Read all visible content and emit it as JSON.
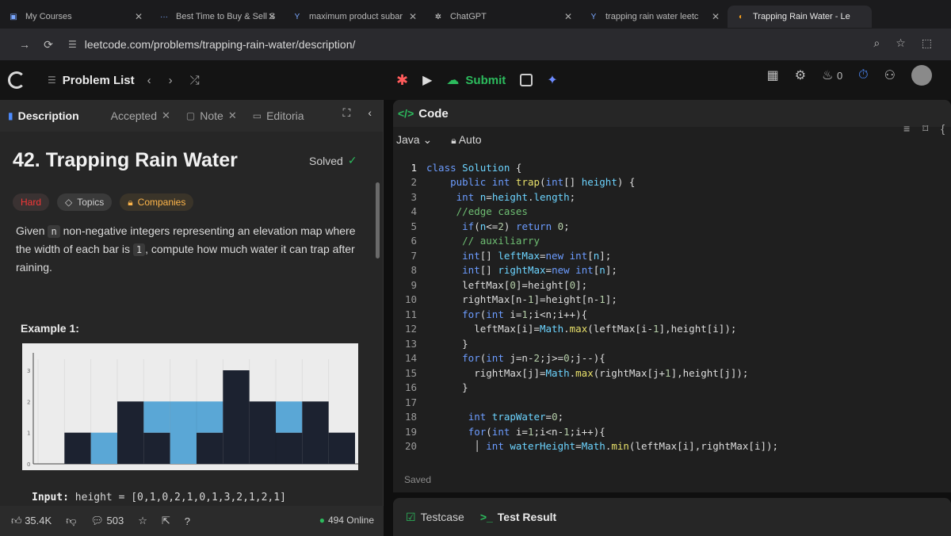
{
  "browser": {
    "tabs": [
      {
        "label": "My Courses"
      },
      {
        "label": "Best Time to Buy & Sell S"
      },
      {
        "label": "maximum product subar"
      },
      {
        "label": "ChatGPT"
      },
      {
        "label": "trapping rain water leetc"
      },
      {
        "label": "Trapping Rain Water - Le"
      }
    ],
    "url": "leetcode.com/problems/trapping-rain-water/description/"
  },
  "header": {
    "problem_list": "Problem List",
    "submit_label": "Submit",
    "streak_count": "0"
  },
  "left": {
    "tabs": {
      "description": "Description",
      "accepted": "Accepted",
      "note": "Note",
      "editorial": "Editoria"
    },
    "title": "42. Trapping Rain Water",
    "solved": "Solved",
    "badges": {
      "difficulty": "Hard",
      "topics": "Topics",
      "companies": "Companies"
    },
    "description": {
      "p1": "Given ",
      "n": "n",
      "p2": " non-negative integers representing an elevation map where the width of each bar is ",
      "one": "1",
      "p3": ", compute how much water it can trap after raining."
    },
    "example_title": "Example 1:",
    "input_label": "Input:",
    "input_value": " height = [0,1,0,2,1,0,1,3,2,1,2,1]",
    "footer": {
      "likes": "35.4K",
      "comments": "503",
      "online": "494 Online"
    }
  },
  "diagram": {
    "heights": [
      0,
      1,
      0,
      2,
      1,
      0,
      1,
      3,
      2,
      1,
      2,
      1
    ],
    "water": [
      0,
      0,
      1,
      0,
      1,
      2,
      1,
      0,
      0,
      1,
      0,
      0
    ],
    "bar_color": "#1c2230",
    "water_color": "#5aa7d6",
    "y_ticks": [
      "0",
      "1",
      "2",
      "3"
    ]
  },
  "code": {
    "title": "Code",
    "language": "Java",
    "mode": "Auto",
    "status": "Saved",
    "lines": [
      {
        "n": "1",
        "html": "<span class='kw'>class</span> <span class='tp'>Solution</span> {"
      },
      {
        "n": "2",
        "html": "    <span class='kw'>public</span> <span class='kw'>int</span> <span class='fn'>trap</span>(<span class='kw'>int</span>[] <span class='tp'>height</span>) {"
      },
      {
        "n": "3",
        "html": "     <span class='kw'>int</span> <span class='tp'>n</span>=<span class='tp'>height</span>.<span class='tp'>length</span>;"
      },
      {
        "n": "4",
        "html": "     <span class='cm'>//edge cases</span>"
      },
      {
        "n": "5",
        "html": "      <span class='kw'>if</span>(<span class='tp'>n</span>&lt;=<span class='num'>2</span>) <span class='kw'>return</span> <span class='num'>0</span>;"
      },
      {
        "n": "6",
        "html": "      <span class='cm'>// auxiliarry</span>"
      },
      {
        "n": "7",
        "html": "      <span class='kw'>int</span>[] <span class='tp'>leftMax</span>=<span class='kw'>new</span> <span class='kw'>int</span>[<span class='tp'>n</span>];"
      },
      {
        "n": "8",
        "html": "      <span class='kw'>int</span>[] <span class='tp'>rightMax</span>=<span class='kw'>new</span> <span class='kw'>int</span>[<span class='tp'>n</span>];"
      },
      {
        "n": "9",
        "html": "      leftMax[<span class='num'>0</span>]=height[<span class='num'>0</span>];"
      },
      {
        "n": "10",
        "html": "      rightMax[n-<span class='num'>1</span>]=height[n-<span class='num'>1</span>];"
      },
      {
        "n": "11",
        "html": "      <span class='kw'>for</span>(<span class='kw'>int</span> i=<span class='num'>1</span>;i&lt;n;i++){"
      },
      {
        "n": "12",
        "html": "        leftMax[i]=<span class='tp'>Math</span>.<span class='fn'>max</span>(leftMax[i-<span class='num'>1</span>],height[i]);"
      },
      {
        "n": "13",
        "html": "      }"
      },
      {
        "n": "14",
        "html": "      <span class='kw'>for</span>(<span class='kw'>int</span> j=n-<span class='num'>2</span>;j&gt;=<span class='num'>0</span>;j--){"
      },
      {
        "n": "15",
        "html": "        rightMax[j]=<span class='tp'>Math</span>.<span class='fn'>max</span>(rightMax[j+<span class='num'>1</span>],height[j]);"
      },
      {
        "n": "16",
        "html": "      }"
      },
      {
        "n": "17",
        "html": ""
      },
      {
        "n": "18",
        "html": "       <span class='kw'>int</span> <span class='tp'>trapWater</span>=<span class='num'>0</span>;"
      },
      {
        "n": "19",
        "html": "       <span class='kw'>for</span>(<span class='kw'>int</span> i=<span class='num'>1</span>;i&lt;n-<span class='num'>1</span>;i++){"
      },
      {
        "n": "20",
        "html": "        │ <span class='kw'>int</span> <span class='tp'>waterHeight</span>=<span class='tp'>Math</span>.<span class='fn'>min</span>(leftMax[i],rightMax[i]);"
      }
    ]
  },
  "bottom": {
    "testcase": "Testcase",
    "test_result": "Test Result"
  }
}
